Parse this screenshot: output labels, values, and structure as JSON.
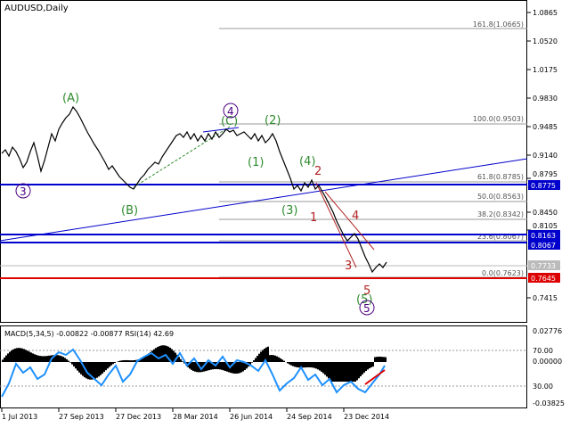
{
  "window": {
    "symbol_title": "AUDUSD,Daily"
  },
  "colors": {
    "background": "#ffffff",
    "price_line": "#000000",
    "blue_level": "#0000cc",
    "red_level": "#dd0000",
    "grid": "#808080",
    "fib": "#999999",
    "wave_green": "#2e8b2e",
    "wave_red": "#b22222",
    "wave_purple": "#4b0082",
    "rsi": "#1e90ff",
    "macd_hist": "#000000",
    "macd_signal_red": "#dd0000"
  },
  "price_axis": {
    "ticks": [
      "1.0865",
      "1.0520",
      "1.0175",
      "0.9830",
      "0.9485",
      "0.9140",
      "0.8795",
      "0.8450",
      "0.8105",
      "0.7415"
    ],
    "badges": [
      {
        "label": "0.8775",
        "kind": "blue"
      },
      {
        "label": "0.8163",
        "kind": "blue"
      },
      {
        "label": "0.8067",
        "kind": "blue"
      },
      {
        "label": "0.7733",
        "kind": "grey"
      },
      {
        "label": "0.7645",
        "kind": "red"
      }
    ]
  },
  "fib_levels": [
    {
      "label": "161.8(1.0665)"
    },
    {
      "label": "100.0(0.9503)"
    },
    {
      "label": "61.8(0.8785)"
    },
    {
      "label": "50.0(0.8563)"
    },
    {
      "label": "38.2(0.8342)"
    },
    {
      "label": "23.6(0.8067)"
    },
    {
      "label": "0.0(0.7623)"
    }
  ],
  "wave_labels": [
    {
      "text": "(A)",
      "color": "green"
    },
    {
      "text": "(B)",
      "color": "green"
    },
    {
      "text": "(C)",
      "color": "green"
    },
    {
      "text": "(1)",
      "color": "green"
    },
    {
      "text": "(2)",
      "color": "green"
    },
    {
      "text": "(3)",
      "color": "green"
    },
    {
      "text": "(4)",
      "color": "green"
    },
    {
      "text": "(5)",
      "color": "green"
    },
    {
      "text": "1",
      "color": "red"
    },
    {
      "text": "2",
      "color": "red"
    },
    {
      "text": "3",
      "color": "red"
    },
    {
      "text": "4",
      "color": "red"
    },
    {
      "text": "5",
      "color": "red"
    },
    {
      "text": "3",
      "color": "purple"
    },
    {
      "text": "4",
      "color": "purple"
    },
    {
      "text": "5",
      "color": "purple"
    }
  ],
  "indicator": {
    "title": "MACD(5,34,5) -0.00822 -0.00877 RSI(14) 42.69",
    "ticks": [
      "0.02776",
      "70.00",
      "0.00000",
      "30.00",
      "-0.03825"
    ]
  },
  "time_axis": {
    "labels": [
      "1 Jul 2013",
      "27 Sep 2013",
      "27 Dec 2013",
      "28 Mar 2014",
      "26 Jun 2014",
      "24 Sep 2014",
      "23 Dec 2014"
    ]
  }
}
